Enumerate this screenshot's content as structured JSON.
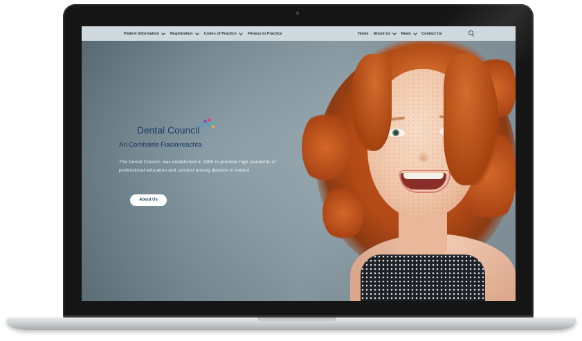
{
  "nav": {
    "left_items": [
      {
        "label": "Patient Information",
        "has_dropdown": true
      },
      {
        "label": "Registration",
        "has_dropdown": true
      },
      {
        "label": "Codes of Practice",
        "has_dropdown": true
      },
      {
        "label": "Fitness to Practice",
        "has_dropdown": false
      }
    ],
    "right_items": [
      {
        "label": "Home",
        "has_dropdown": false
      },
      {
        "label": "About Us",
        "has_dropdown": true
      },
      {
        "label": "News",
        "has_dropdown": true
      },
      {
        "label": "Contact Us",
        "has_dropdown": false
      }
    ],
    "search_icon": "search-icon"
  },
  "hero": {
    "logo_text": "Dental Council",
    "subtitle": "An Comhairle Fiaclóireachta",
    "description": "The Dental Council, was established in 1985 to promote high standards of professional education and conduct among dentists in Ireland.",
    "button_label": "About Us"
  },
  "colors": {
    "nav_bg": "#cfd8dc",
    "brand_navy": "#16395c",
    "hero_bg": "#7c919c",
    "logo_dots": [
      "#4a9fd8",
      "#7b5cb5",
      "#e0457b",
      "#3bb8a0",
      "#f2a93b"
    ]
  }
}
